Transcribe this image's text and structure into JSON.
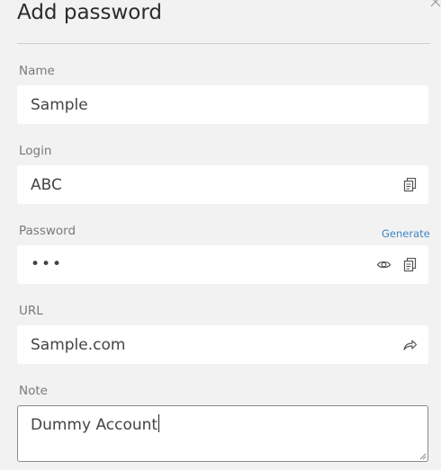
{
  "dialog": {
    "title": "Add password",
    "close_icon": "close-icon"
  },
  "fields": {
    "name": {
      "label": "Name",
      "value": "Sample"
    },
    "login": {
      "label": "Login",
      "value": "ABC",
      "icon": "copy-icon"
    },
    "password": {
      "label": "Password",
      "value": "•••",
      "generate_label": "Generate",
      "icons": [
        "eye-icon",
        "copy-icon"
      ]
    },
    "url": {
      "label": "URL",
      "value": "Sample.com",
      "icon": "open-link-icon"
    },
    "note": {
      "label": "Note",
      "value": "Dummy Account"
    }
  },
  "colors": {
    "background": "#f2f2f2",
    "field_background": "#ffffff",
    "link": "#3d86c6",
    "label": "#7a7a7a"
  }
}
